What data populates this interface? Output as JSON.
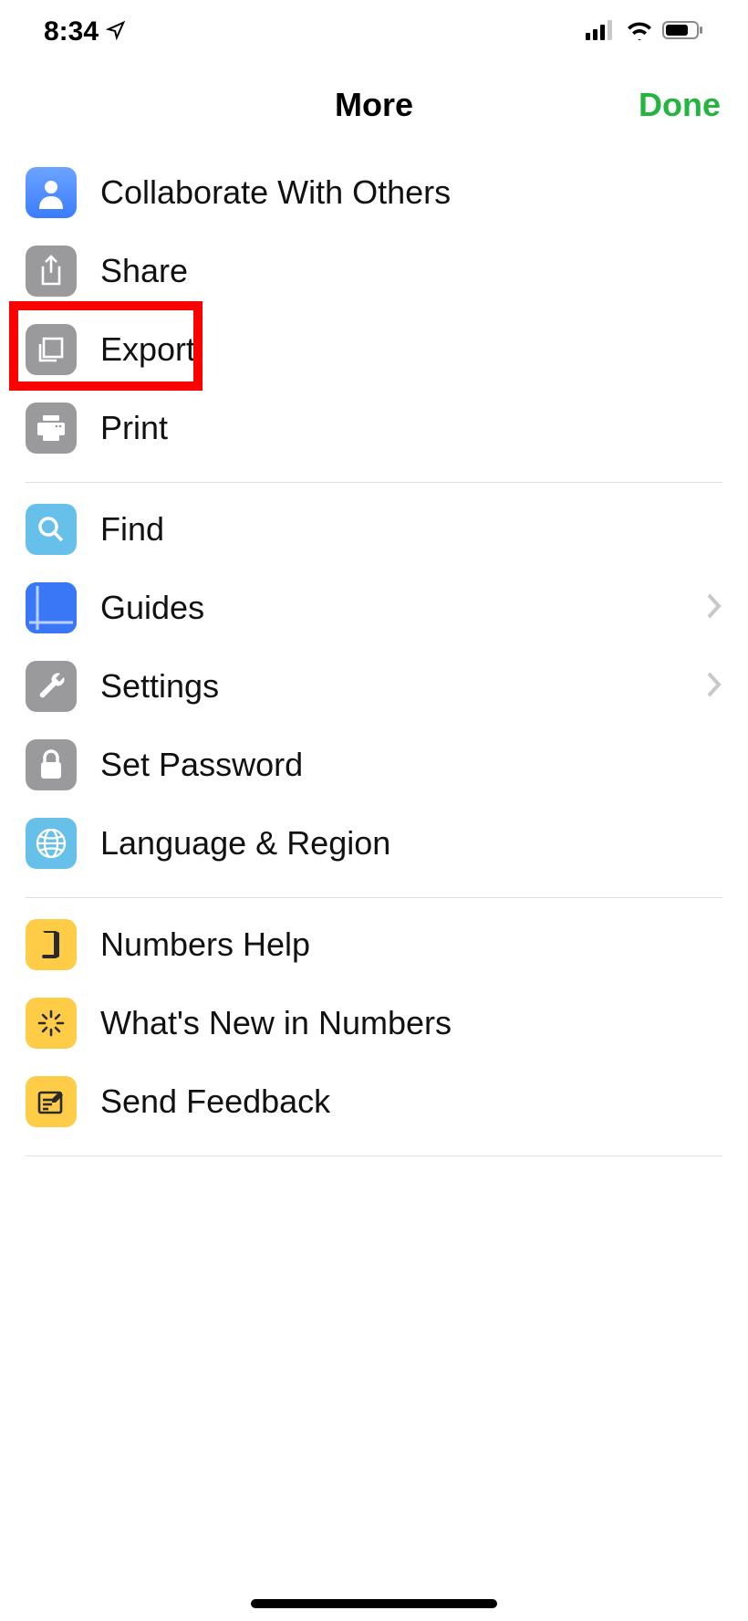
{
  "status": {
    "time": "8:34",
    "location_visible": true
  },
  "header": {
    "title": "More",
    "done_label": "Done"
  },
  "menu": {
    "section1": [
      {
        "label": "Collaborate With Others"
      },
      {
        "label": "Share"
      },
      {
        "label": "Export"
      },
      {
        "label": "Print"
      }
    ],
    "section2": [
      {
        "label": "Find"
      },
      {
        "label": "Guides"
      },
      {
        "label": "Settings"
      },
      {
        "label": "Set Password"
      },
      {
        "label": "Language & Region"
      }
    ],
    "section3": [
      {
        "label": "Numbers Help"
      },
      {
        "label": "What's New in Numbers"
      },
      {
        "label": "Send Feedback"
      }
    ]
  },
  "highlighted_item": "Export"
}
